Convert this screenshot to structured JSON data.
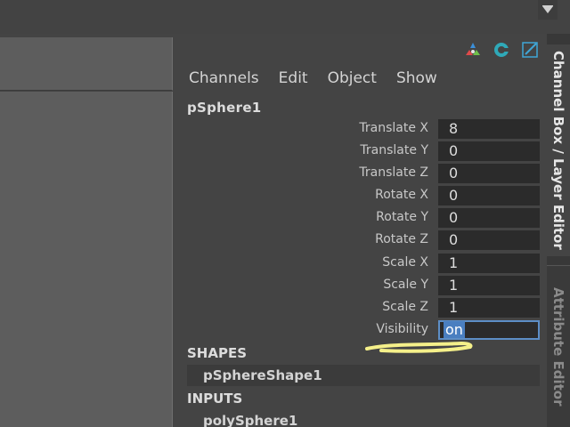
{
  "colors": {
    "background": "#444444",
    "field_background": "#2b2b2b",
    "selection": "#4a7fc0",
    "highlight_mark": "#f5f08a"
  },
  "toolbar": {
    "icons": [
      "channel-toggle-icon",
      "layer-editor-icon",
      "attribute-editor-icon"
    ]
  },
  "menu": {
    "items": [
      {
        "label": "Channels"
      },
      {
        "label": "Edit"
      },
      {
        "label": "Object"
      },
      {
        "label": "Show"
      }
    ]
  },
  "object_name": "pSphere1",
  "attributes": [
    {
      "label": "Translate X",
      "value": "8"
    },
    {
      "label": "Translate Y",
      "value": "0"
    },
    {
      "label": "Translate Z",
      "value": "0"
    },
    {
      "label": "Rotate X",
      "value": "0"
    },
    {
      "label": "Rotate Y",
      "value": "0"
    },
    {
      "label": "Rotate Z",
      "value": "0"
    },
    {
      "label": "Scale X",
      "value": "1"
    },
    {
      "label": "Scale Y",
      "value": "1"
    },
    {
      "label": "Scale Z",
      "value": "1"
    },
    {
      "label": "Visibility",
      "value": "on"
    }
  ],
  "shapes": {
    "header": "SHAPES",
    "items": [
      "pSphereShape1"
    ]
  },
  "inputs": {
    "header": "INPUTS",
    "items": [
      "polySphere1"
    ]
  },
  "side_tabs": {
    "active": "Channel Box / Layer Editor",
    "inactive": "Attribute Editor"
  }
}
